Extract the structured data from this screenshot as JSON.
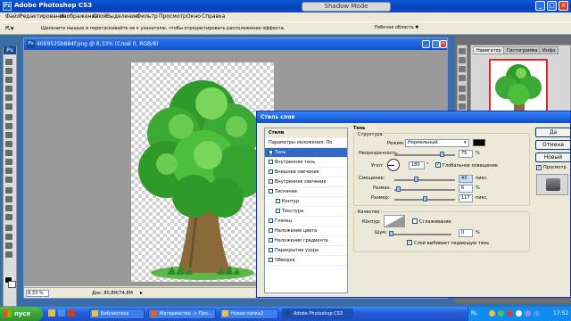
{
  "app": {
    "title": "Adobe Photoshop CS3",
    "shadow_mode": "Shadow Mode"
  },
  "menu": [
    "Файл",
    "Редактирование",
    "Изображение",
    "Слой",
    "Выделение",
    "Фильтр",
    "Просмотр",
    "Окно",
    "Справка"
  ],
  "options": {
    "hint": "Щелкните мышью и перетаскивайте ее к указателю, чтобы отредактировать расположение эффекта.",
    "workspace": "Рабочая область ▼"
  },
  "document": {
    "title": "4009525b884f.png @ 8,33% (Слой 0, RGB/8)",
    "zoom": "8,33 %",
    "size": "Док: 80,8M/74,8M"
  },
  "panels": {
    "tabs": [
      "Навигатор",
      "Гистограмма",
      "Инфо"
    ]
  },
  "dialog": {
    "title": "Стиль слоя",
    "styles_header": "Стили",
    "blend_options": "Параметры наложения: По умолчанию",
    "style_items": [
      {
        "label": "Тень",
        "checked": true
      },
      {
        "label": "Внутренняя тень",
        "checked": false
      },
      {
        "label": "Внешнее свечение",
        "checked": false
      },
      {
        "label": "Внутреннее свечение",
        "checked": false
      },
      {
        "label": "Тиснение",
        "checked": false
      },
      {
        "label": "Контур",
        "checked": false
      },
      {
        "label": "Текстура",
        "checked": false
      },
      {
        "label": "Глянец",
        "checked": false
      },
      {
        "label": "Наложение цвета",
        "checked": false
      },
      {
        "label": "Наложение градиента",
        "checked": false
      },
      {
        "label": "Перекрытие узора",
        "checked": false
      },
      {
        "label": "Обводка",
        "checked": false
      }
    ],
    "section_title": "Тень",
    "structure_title": "Структура",
    "mode_label": "Режим:",
    "mode_value": "Нормальный",
    "opacity_label": "Непрозрачность:",
    "opacity_value": "75",
    "angle_label": "Угол:",
    "angle_value": "180",
    "global_light_label": "Глобальное освещение",
    "distance_label": "Смещение:",
    "distance_value": "43",
    "spread_label": "Размах:",
    "spread_value": "6",
    "size_label": "Размер:",
    "size_value": "117",
    "percent_unit": "%",
    "deg_unit": "°",
    "px_unit": "пикс.",
    "quality_title": "Качество",
    "contour_label": "Контур:",
    "antialias_label": "Сглаживание",
    "noise_label": "Шум:",
    "noise_value": "0",
    "knockout_label": "Слой выбивает падающую тень",
    "buttons": {
      "ok": "Да",
      "cancel": "Отмена",
      "new_style": "Новый стиль...",
      "preview": "Просмотр"
    }
  },
  "taskbar": {
    "start": "пуск",
    "tasks": [
      "Библиотека",
      "Материнство -> Про...",
      "Новая папка2",
      "Adobe Photoshop CS3"
    ],
    "lang": "RL",
    "clock": "17:52"
  },
  "colors": {
    "titlebar": "#0a58d8",
    "selection": "#316ac5",
    "tree_green": "#3aa935",
    "trunk": "#8b6a3a"
  }
}
